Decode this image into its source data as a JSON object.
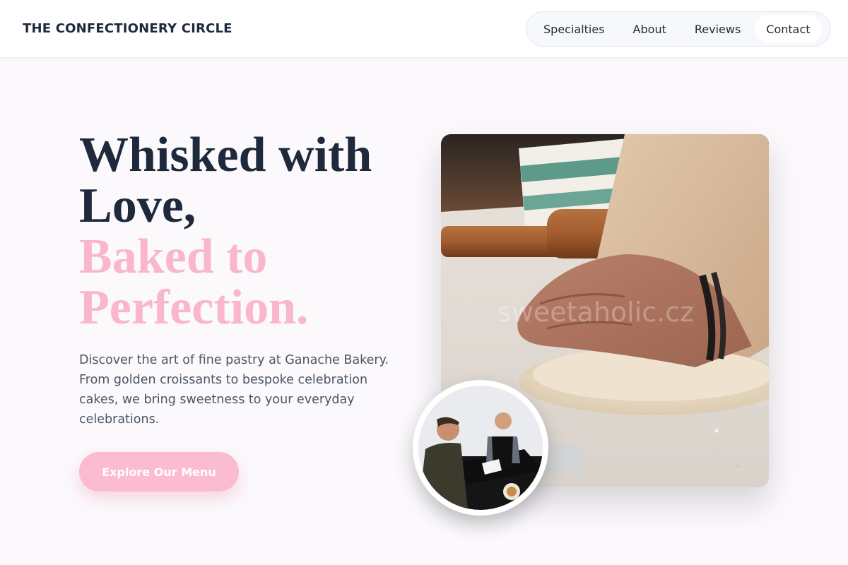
{
  "header": {
    "brand": "THE CONFECTIONERY CIRCLE",
    "nav": [
      {
        "label": "Specialties"
      },
      {
        "label": "About"
      },
      {
        "label": "Reviews"
      },
      {
        "label": "Contact"
      }
    ]
  },
  "hero": {
    "title_line1": "Whisked with",
    "title_line2": "Love,",
    "title_line3": "Baked to",
    "title_line4": "Perfection.",
    "description": "Discover the art of fine pastry at Ganache Bakery. From golden croissants to bespoke celebration cakes, we bring sweetness to your everyday celebrations.",
    "cta_label": "Explore Our Menu",
    "main_image_watermark": "sweetaholic.cz"
  },
  "colors": {
    "accent_pink": "#f9b6cc",
    "button_pink": "#fbbbd0",
    "heading_dark": "#1e293b",
    "body_text": "#4b5563",
    "background": "#fbf9fc"
  }
}
